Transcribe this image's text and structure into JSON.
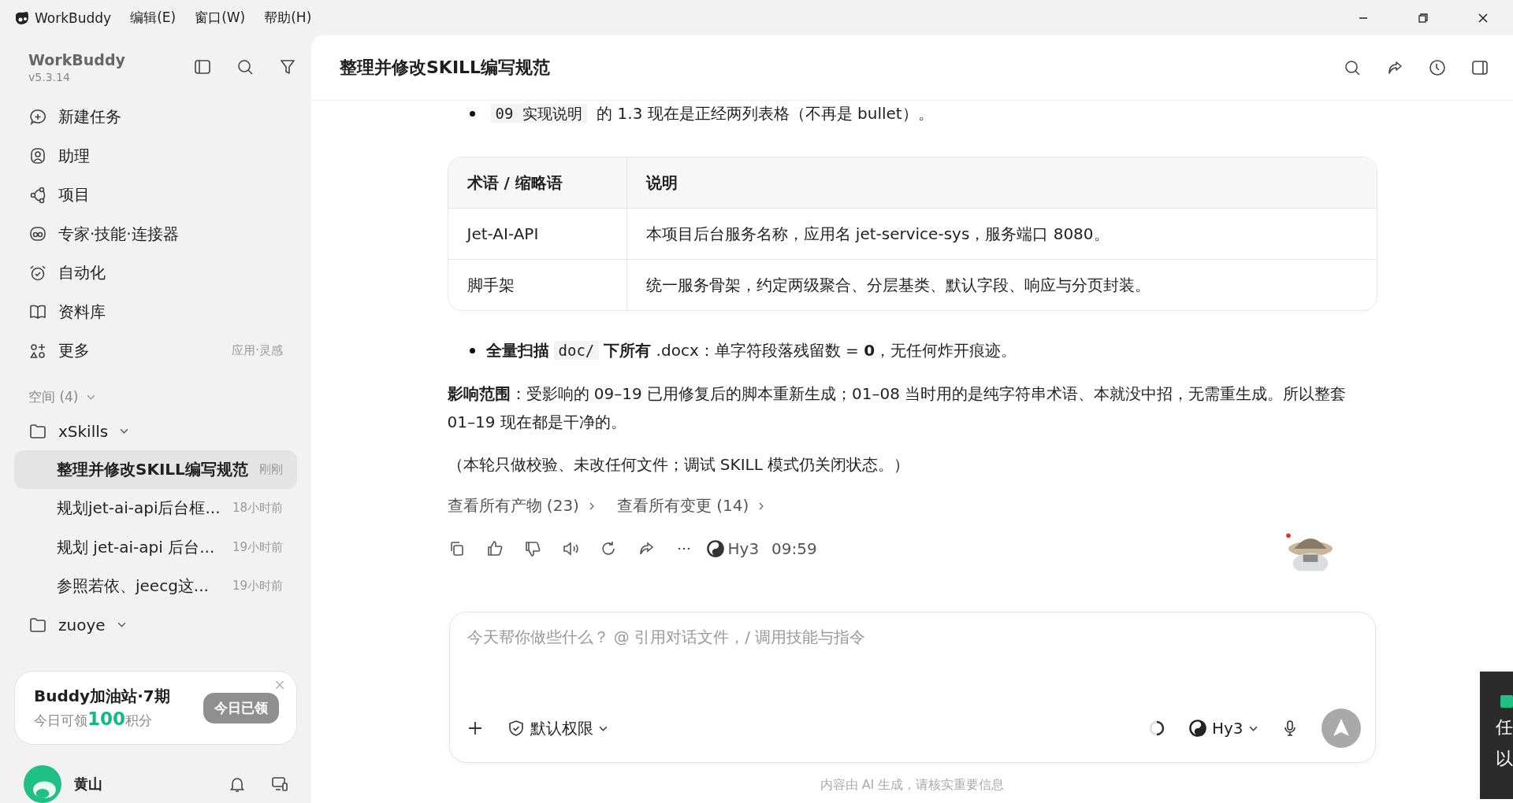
{
  "menu_bar": {
    "app_name": "WorkBuddy",
    "menus": [
      "编辑(E)",
      "窗口(W)",
      "帮助(H)"
    ]
  },
  "sidebar": {
    "app_name": "WorkBuddy",
    "version": "v5.3.14",
    "nav": [
      {
        "kind": "new",
        "label": "新建任务"
      },
      {
        "kind": "assistant",
        "label": "助理"
      },
      {
        "kind": "project",
        "label": "项目"
      },
      {
        "kind": "experts",
        "label": "专家·技能·连接器"
      },
      {
        "kind": "automation",
        "label": "自动化"
      },
      {
        "kind": "library",
        "label": "资料库"
      },
      {
        "kind": "more",
        "label": "更多",
        "hint": "应用·灵感"
      }
    ],
    "spaces_label": "空间 (4)",
    "folders": [
      {
        "name": "xSkills",
        "expanded": true,
        "tasks": [
          {
            "title": "整理并修改SKILL编写规范",
            "time": "刚刚",
            "selected": true
          },
          {
            "title": "规划jet-ai-api后台框...",
            "time": "18小时前",
            "selected": false
          },
          {
            "title": "规划 jet-ai-api 后台...",
            "time": "19小时前",
            "selected": false
          },
          {
            "title": "参照若依、jeecg这...",
            "time": "19小时前",
            "selected": false
          }
        ]
      },
      {
        "name": "zuoye",
        "expanded": true
      }
    ],
    "promo": {
      "title": "Buddy加油站·7期",
      "prefix": "今日可领",
      "points": "100",
      "suffix": "积分",
      "button": "今日已领",
      "claimed": true
    },
    "user": {
      "name": "黄山"
    }
  },
  "main": {
    "title": "整理并修改SKILL编写规范",
    "content": [
      {
        "kind": "bullet",
        "parts": [
          {
            "kind": "code",
            "text": "09 实现说明"
          },
          {
            "kind": "plain",
            "text": " 的 1.3 现在是正经两列表格（不再是 bullet）。"
          }
        ]
      },
      {
        "kind": "table",
        "columns": [
          "术语 / 缩略语",
          "说明"
        ],
        "rows": [
          [
            "Jet-AI-API",
            "本项目后台服务名称，应用名 jet-service-sys，服务端口 8080。"
          ],
          [
            "脚手架",
            "统一服务骨架，约定两级聚合、分层基类、默认字段、响应与分页封装。"
          ]
        ]
      },
      {
        "kind": "bullet",
        "parts": [
          {
            "kind": "bold",
            "text": "全量扫描"
          },
          {
            "kind": "code",
            "text": "doc/"
          },
          {
            "kind": "bold",
            "text": "下所有"
          },
          {
            "kind": "plain",
            "text": " .docx：单字符段落残留数 = "
          },
          {
            "kind": "bold",
            "text": "0"
          },
          {
            "kind": "plain",
            "text": "，无任何炸开痕迹。"
          }
        ]
      },
      {
        "kind": "paragraph",
        "text": "**影响范围**：受影响的 09–19 已用修复后的脚本重新生成；01–08 当时用的是纯字符串术语、本就没中招，无需重生成。所以整套 01–19 现在都是干净的。"
      },
      {
        "kind": "paragraph",
        "text": "（本轮只做校验、未改任何文件；调试 SKILL 模式仍关闭状态。）"
      }
    ],
    "links": [
      "查看所有产物 (23)",
      "查看所有变更 (14)"
    ],
    "model": "Hy3",
    "time": "09:59"
  },
  "composer": {
    "placeholder": "今天帮你做些什么？ @ 引用对话文件，/ 调用技能与指令",
    "permission": "默认权限",
    "model": "Hy3"
  },
  "disclaimer": "内容由 AI 生成，请核实重要信息",
  "side_widget": {
    "texts": [
      "任",
      "以"
    ]
  }
}
